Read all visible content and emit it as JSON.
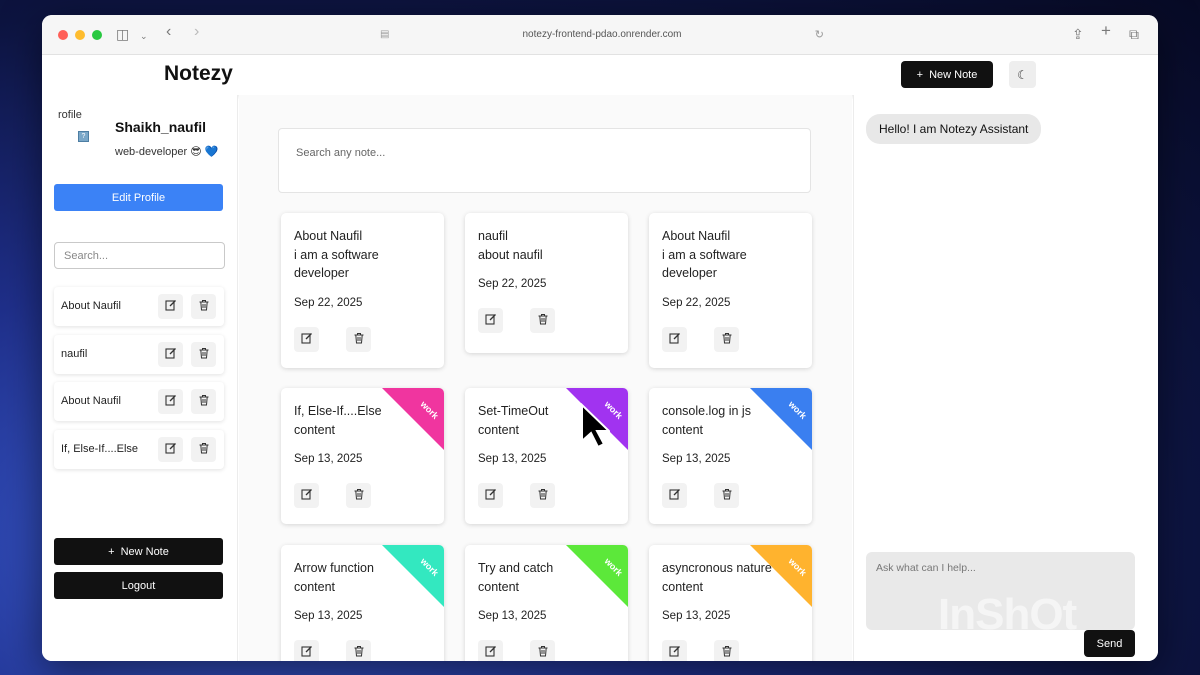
{
  "browser": {
    "url": "notezy-frontend-pdao.onrender.com"
  },
  "header": {
    "logo": "Notezy",
    "new_note_label": "New Note"
  },
  "sidebar": {
    "avatar_alt": "rofile",
    "username": "Shaikh_naufil",
    "bio": "web-developer 😎 💙",
    "edit_profile_label": "Edit Profile",
    "search_placeholder": "Search...",
    "items": [
      {
        "label": "About Naufil"
      },
      {
        "label": "naufil"
      },
      {
        "label": "About Naufil"
      },
      {
        "label": "If, Else-If....Else"
      }
    ],
    "new_note_label": "New Note",
    "logout_label": "Logout"
  },
  "main": {
    "search_placeholder": "Search any note...",
    "cards": [
      {
        "title": "About Naufil",
        "content": "i am a software developer",
        "date": "Sep 22, 2025",
        "tag": ""
      },
      {
        "title": "naufil",
        "content": "about naufil",
        "date": "Sep 22, 2025",
        "tag": ""
      },
      {
        "title": "About Naufil",
        "content": "i am a software developer",
        "date": "Sep 22, 2025",
        "tag": ""
      },
      {
        "title": "If, Else-If....Else",
        "content": "content",
        "date": "Sep 13, 2025",
        "tag": "work",
        "tag_color": "#f0359f"
      },
      {
        "title": "Set-TimeOut",
        "content": "content",
        "date": "Sep 13, 2025",
        "tag": "work",
        "tag_color": "#a133f0"
      },
      {
        "title": "console.log in js",
        "content": "content",
        "date": "Sep 13, 2025",
        "tag": "work",
        "tag_color": "#3a7ff0"
      },
      {
        "title": "Arrow function",
        "content": "content",
        "date": "Sep 13, 2025",
        "tag": "work",
        "tag_color": "#33e8c0"
      },
      {
        "title": "Try and catch",
        "content": "content",
        "date": "Sep 13, 2025",
        "tag": "work",
        "tag_color": "#5ce83a"
      },
      {
        "title": "asyncronous nature",
        "content": "content",
        "date": "Sep 13, 2025",
        "tag": "work",
        "tag_color": "#ffb32e"
      }
    ]
  },
  "chat": {
    "greeting": "Hello! I am Notezy Assistant",
    "input_placeholder": "Ask what can I help...",
    "send_label": "Send"
  },
  "watermark": "InShOt"
}
